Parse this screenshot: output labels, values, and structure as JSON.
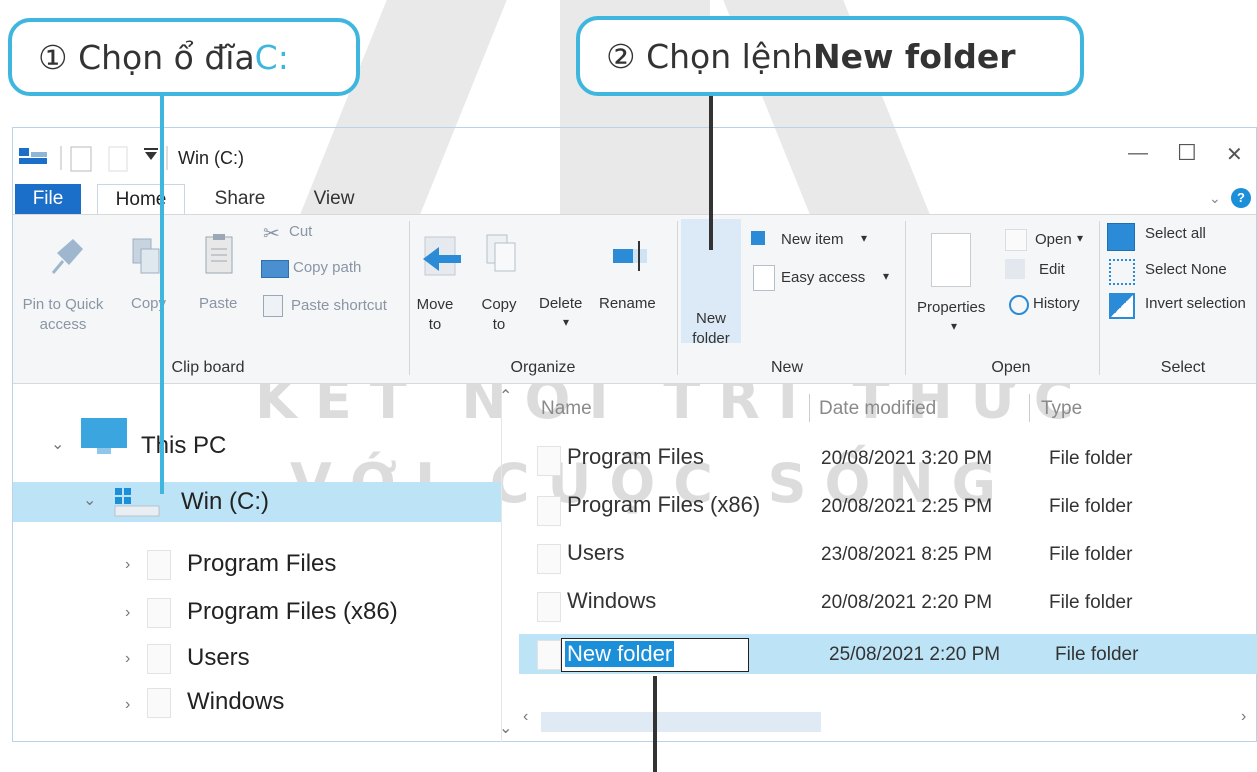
{
  "callouts": {
    "step1": {
      "num": "①",
      "text": "Chọn ổ đĩa ",
      "drive": "C:"
    },
    "step2": {
      "num": "②",
      "text": "Chọn lệnh ",
      "cmd": "New folder"
    }
  },
  "watermark": {
    "line1": "KẾT NỐI TRI THỨC",
    "line2": "VỚI CUỘC SỐNG"
  },
  "window": {
    "title": "Win (C:)",
    "controls": {
      "minimize": "—",
      "maximize": "☐",
      "close": "✕",
      "help": "?"
    },
    "tabs": [
      "File",
      "Home",
      "Share",
      "View"
    ]
  },
  "ribbon": {
    "clipboard": {
      "label": "Clip board",
      "pin": "Pin to Quick access",
      "copy": "Copy",
      "paste": "Paste",
      "cut": "Cut",
      "copy_path": "Copy path",
      "paste_shortcut": "Paste shortcut"
    },
    "organize": {
      "label": "Organize",
      "move_to": "Move to",
      "copy_to": "Copy to",
      "delete": "Delete",
      "rename": "Rename"
    },
    "new": {
      "label": "New",
      "new_folder": "New folder",
      "new_item": "New item",
      "easy_access": "Easy access"
    },
    "open": {
      "label": "Open",
      "properties": "Properties",
      "open": "Open",
      "edit": "Edit",
      "history": "History"
    },
    "select": {
      "label": "Select",
      "select_all": "Select all",
      "select_none": "Select None",
      "invert": "Invert selection"
    }
  },
  "nav": {
    "this_pc": "This PC",
    "drive": "Win (C:)",
    "folders": [
      "Program Files",
      "Program Files (x86)",
      "Users",
      "Windows"
    ]
  },
  "columns": {
    "name": "Name",
    "date": "Date modified",
    "type": "Type"
  },
  "files": [
    {
      "name": "Program Files",
      "date": "20/08/2021 3:20 PM",
      "type": "File folder"
    },
    {
      "name": "Program Files (x86)",
      "date": "20/08/2021 2:25 PM",
      "type": "File folder"
    },
    {
      "name": "Users",
      "date": "23/08/2021 8:25 PM",
      "type": "File folder"
    },
    {
      "name": "Windows",
      "date": "20/08/2021 2:20 PM",
      "type": "File folder"
    },
    {
      "name": "New folder",
      "date": "25/08/2021 2:20 PM",
      "type": "File folder"
    }
  ],
  "colors": {
    "accent": "#3fb6dd",
    "selection": "#bde3f7",
    "file_tab": "#1c6fc9"
  }
}
